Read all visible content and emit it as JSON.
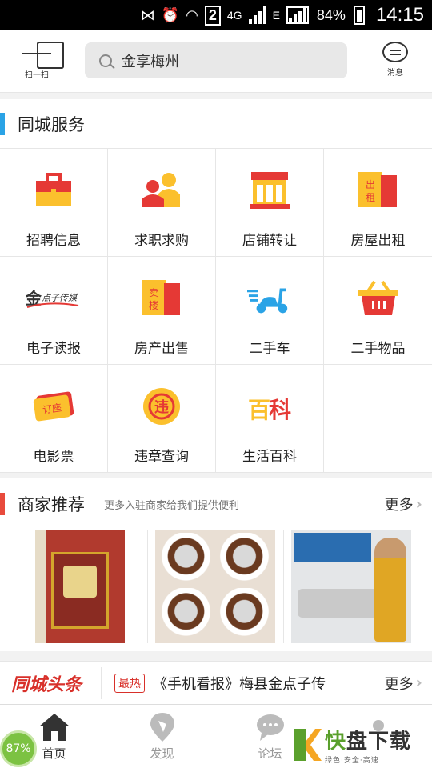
{
  "statusbar": {
    "network": "4G",
    "network_e": "E",
    "sim_slot": "2",
    "battery": "84%",
    "time": "14:15"
  },
  "header": {
    "scan_label": "扫一扫",
    "search_text": "金享梅州",
    "message_label": "消息"
  },
  "services": {
    "title": "同城服务",
    "items": [
      {
        "label": "招聘信息",
        "icon": "briefcase-icon"
      },
      {
        "label": "求职求购",
        "icon": "people-icon"
      },
      {
        "label": "店铺转让",
        "icon": "storefront-icon"
      },
      {
        "label": "房屋出租",
        "icon": "rent-sign-icon",
        "badge": "出租"
      },
      {
        "label": "电子读报",
        "icon": "jindianzi-media-logo",
        "logo_text": "点子传媒"
      },
      {
        "label": "房产出售",
        "icon": "sale-sign-icon",
        "badge": "卖楼"
      },
      {
        "label": "二手车",
        "icon": "scooter-icon"
      },
      {
        "label": "二手物品",
        "icon": "basket-icon"
      },
      {
        "label": "电影票",
        "icon": "ticket-icon",
        "badge": "订座"
      },
      {
        "label": "违章查询",
        "icon": "violation-icon",
        "badge": "违"
      },
      {
        "label": "生活百科",
        "icon": "encyclopedia-icon",
        "badge": "百科"
      }
    ]
  },
  "merchants": {
    "title": "商家推荐",
    "subtitle": "更多入驻商家给我们提供便利",
    "more": "更多"
  },
  "news": {
    "logo": "同城头条",
    "tag": "最热",
    "headline": "《手机看报》梅县金点子传",
    "more": "更多"
  },
  "tabs": [
    {
      "label": "首页",
      "icon": "home-icon",
      "active": true
    },
    {
      "label": "发现",
      "icon": "discover-pin-icon",
      "active": false
    },
    {
      "label": "论坛",
      "icon": "forum-icon",
      "active": false
    },
    {
      "label": "",
      "icon": "profile-icon",
      "active": false
    }
  ],
  "overlay": {
    "memory_percent": "87%",
    "watermark_main_a": "快",
    "watermark_main_b": "盘下载",
    "watermark_sub": "绿色·安全·高速"
  },
  "colors": {
    "accent_blue": "#2aa3e6",
    "accent_red": "#e84a3c",
    "icon_yellow": "#fbc02d",
    "icon_red": "#e53935"
  }
}
